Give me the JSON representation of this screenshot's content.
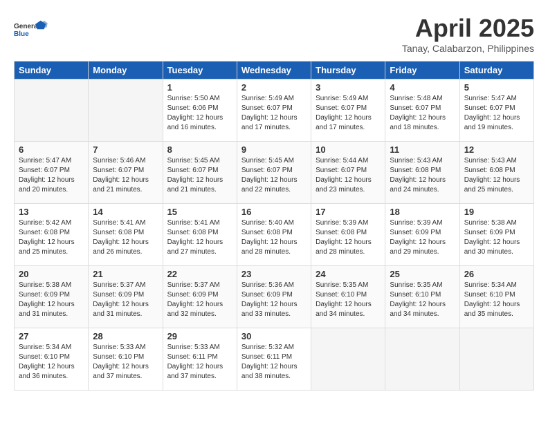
{
  "header": {
    "logo_general": "General",
    "logo_blue": "Blue",
    "title": "April 2025",
    "location": "Tanay, Calabarzon, Philippines"
  },
  "days_of_week": [
    "Sunday",
    "Monday",
    "Tuesday",
    "Wednesday",
    "Thursday",
    "Friday",
    "Saturday"
  ],
  "weeks": [
    [
      {
        "day": "",
        "info": ""
      },
      {
        "day": "",
        "info": ""
      },
      {
        "day": "1",
        "info": "Sunrise: 5:50 AM\nSunset: 6:06 PM\nDaylight: 12 hours\nand 16 minutes."
      },
      {
        "day": "2",
        "info": "Sunrise: 5:49 AM\nSunset: 6:07 PM\nDaylight: 12 hours\nand 17 minutes."
      },
      {
        "day": "3",
        "info": "Sunrise: 5:49 AM\nSunset: 6:07 PM\nDaylight: 12 hours\nand 17 minutes."
      },
      {
        "day": "4",
        "info": "Sunrise: 5:48 AM\nSunset: 6:07 PM\nDaylight: 12 hours\nand 18 minutes."
      },
      {
        "day": "5",
        "info": "Sunrise: 5:47 AM\nSunset: 6:07 PM\nDaylight: 12 hours\nand 19 minutes."
      }
    ],
    [
      {
        "day": "6",
        "info": "Sunrise: 5:47 AM\nSunset: 6:07 PM\nDaylight: 12 hours\nand 20 minutes."
      },
      {
        "day": "7",
        "info": "Sunrise: 5:46 AM\nSunset: 6:07 PM\nDaylight: 12 hours\nand 21 minutes."
      },
      {
        "day": "8",
        "info": "Sunrise: 5:45 AM\nSunset: 6:07 PM\nDaylight: 12 hours\nand 21 minutes."
      },
      {
        "day": "9",
        "info": "Sunrise: 5:45 AM\nSunset: 6:07 PM\nDaylight: 12 hours\nand 22 minutes."
      },
      {
        "day": "10",
        "info": "Sunrise: 5:44 AM\nSunset: 6:07 PM\nDaylight: 12 hours\nand 23 minutes."
      },
      {
        "day": "11",
        "info": "Sunrise: 5:43 AM\nSunset: 6:08 PM\nDaylight: 12 hours\nand 24 minutes."
      },
      {
        "day": "12",
        "info": "Sunrise: 5:43 AM\nSunset: 6:08 PM\nDaylight: 12 hours\nand 25 minutes."
      }
    ],
    [
      {
        "day": "13",
        "info": "Sunrise: 5:42 AM\nSunset: 6:08 PM\nDaylight: 12 hours\nand 25 minutes."
      },
      {
        "day": "14",
        "info": "Sunrise: 5:41 AM\nSunset: 6:08 PM\nDaylight: 12 hours\nand 26 minutes."
      },
      {
        "day": "15",
        "info": "Sunrise: 5:41 AM\nSunset: 6:08 PM\nDaylight: 12 hours\nand 27 minutes."
      },
      {
        "day": "16",
        "info": "Sunrise: 5:40 AM\nSunset: 6:08 PM\nDaylight: 12 hours\nand 28 minutes."
      },
      {
        "day": "17",
        "info": "Sunrise: 5:39 AM\nSunset: 6:08 PM\nDaylight: 12 hours\nand 28 minutes."
      },
      {
        "day": "18",
        "info": "Sunrise: 5:39 AM\nSunset: 6:09 PM\nDaylight: 12 hours\nand 29 minutes."
      },
      {
        "day": "19",
        "info": "Sunrise: 5:38 AM\nSunset: 6:09 PM\nDaylight: 12 hours\nand 30 minutes."
      }
    ],
    [
      {
        "day": "20",
        "info": "Sunrise: 5:38 AM\nSunset: 6:09 PM\nDaylight: 12 hours\nand 31 minutes."
      },
      {
        "day": "21",
        "info": "Sunrise: 5:37 AM\nSunset: 6:09 PM\nDaylight: 12 hours\nand 31 minutes."
      },
      {
        "day": "22",
        "info": "Sunrise: 5:37 AM\nSunset: 6:09 PM\nDaylight: 12 hours\nand 32 minutes."
      },
      {
        "day": "23",
        "info": "Sunrise: 5:36 AM\nSunset: 6:09 PM\nDaylight: 12 hours\nand 33 minutes."
      },
      {
        "day": "24",
        "info": "Sunrise: 5:35 AM\nSunset: 6:10 PM\nDaylight: 12 hours\nand 34 minutes."
      },
      {
        "day": "25",
        "info": "Sunrise: 5:35 AM\nSunset: 6:10 PM\nDaylight: 12 hours\nand 34 minutes."
      },
      {
        "day": "26",
        "info": "Sunrise: 5:34 AM\nSunset: 6:10 PM\nDaylight: 12 hours\nand 35 minutes."
      }
    ],
    [
      {
        "day": "27",
        "info": "Sunrise: 5:34 AM\nSunset: 6:10 PM\nDaylight: 12 hours\nand 36 minutes."
      },
      {
        "day": "28",
        "info": "Sunrise: 5:33 AM\nSunset: 6:10 PM\nDaylight: 12 hours\nand 37 minutes."
      },
      {
        "day": "29",
        "info": "Sunrise: 5:33 AM\nSunset: 6:11 PM\nDaylight: 12 hours\nand 37 minutes."
      },
      {
        "day": "30",
        "info": "Sunrise: 5:32 AM\nSunset: 6:11 PM\nDaylight: 12 hours\nand 38 minutes."
      },
      {
        "day": "",
        "info": ""
      },
      {
        "day": "",
        "info": ""
      },
      {
        "day": "",
        "info": ""
      }
    ]
  ]
}
